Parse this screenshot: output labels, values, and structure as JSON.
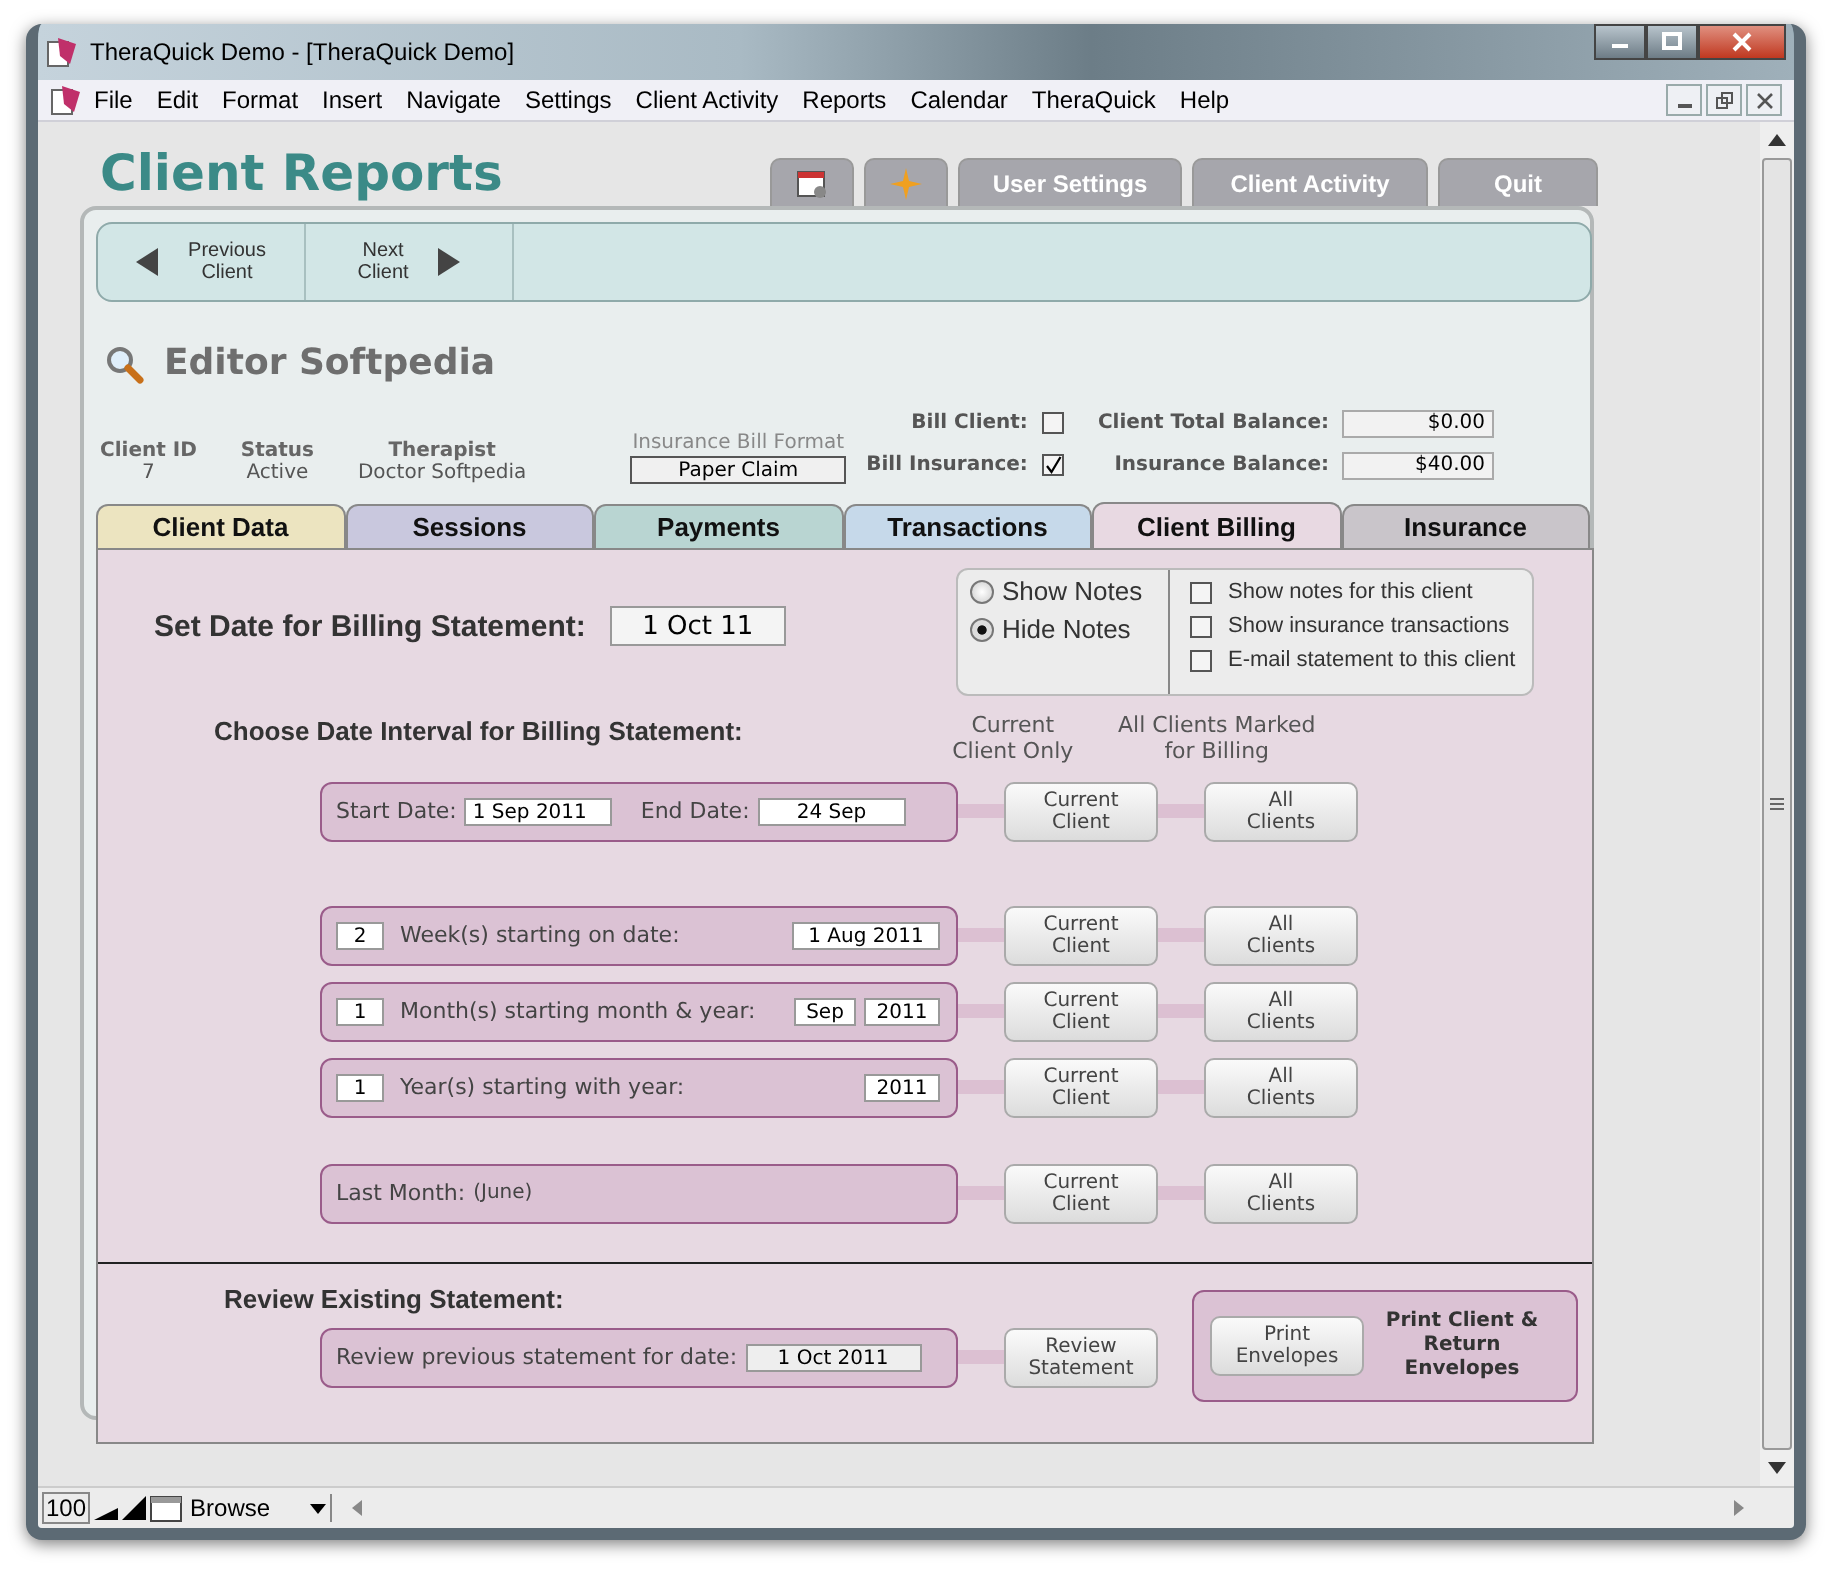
{
  "window": {
    "title": "TheraQuick Demo - [TheraQuick Demo]"
  },
  "menu": [
    "File",
    "Edit",
    "Format",
    "Insert",
    "Navigate",
    "Settings",
    "Client Activity",
    "Reports",
    "Calendar",
    "TheraQuick",
    "Help"
  ],
  "header": {
    "title": "Client Reports",
    "tabs": [
      {
        "kind": "calendar"
      },
      {
        "kind": "star"
      },
      {
        "kind": "text",
        "label": "User Settings"
      },
      {
        "kind": "text",
        "label": "Client Activity"
      },
      {
        "kind": "text",
        "label": "Quit"
      }
    ]
  },
  "navigation": {
    "previous": "Previous Client",
    "next": "Next Client"
  },
  "client": {
    "name": "Editor Softpedia",
    "fields": [
      {
        "label": "Client ID",
        "value": "7"
      },
      {
        "label": "Status",
        "value": "Active"
      },
      {
        "label": "Therapist",
        "value": "Doctor Softpedia"
      }
    ],
    "insurance_bill_format": {
      "label": "Insurance Bill Format",
      "value": "Paper Claim"
    },
    "bill_options": [
      {
        "label": "Bill Client:",
        "checked": false
      },
      {
        "label": "Bill Insurance:",
        "checked": true
      }
    ],
    "balances": [
      {
        "label": "Client Total Balance:",
        "value": "$0.00"
      },
      {
        "label": "Insurance Balance:",
        "value": "$40.00"
      }
    ]
  },
  "tabs": [
    {
      "label": "Client Data",
      "color": "#ece4c0",
      "selected": false
    },
    {
      "label": "Sessions",
      "color": "#c9c8de",
      "selected": false
    },
    {
      "label": "Payments",
      "color": "#b9d5d2",
      "selected": false
    },
    {
      "label": "Transactions",
      "color": "#c6d9ea",
      "selected": false
    },
    {
      "label": "Client Billing",
      "color": "#e8d9e2",
      "selected": true
    },
    {
      "label": "Insurance",
      "color": "#c9c5ca",
      "selected": false
    }
  ],
  "billing": {
    "statement_date": {
      "label": "Set Date for Billing Statement:",
      "value": "1 Oct 11"
    },
    "notes_options": [
      {
        "label": "Show Notes",
        "selected": false
      },
      {
        "label": "Hide Notes",
        "selected": true
      }
    ],
    "options": [
      {
        "label": "Show notes for this client",
        "checked": false
      },
      {
        "label": "Show insurance transactions",
        "checked": false
      },
      {
        "label": "E-mail statement to this client",
        "checked": false
      }
    ],
    "interval_heading": "Choose Date Interval for Billing Statement:",
    "column_headings": [
      "Current Client Only",
      "All Clients Marked for Billing"
    ],
    "intervals": [
      {
        "kind": "range",
        "start_label": "Start Date:",
        "start": "1 Sep 2011",
        "end_label": "End Date:",
        "end": "24 Sep",
        "buttons": [
          "Current Client",
          "All Clients"
        ]
      },
      {
        "kind": "weeks",
        "count": "2",
        "label": "Week(s) starting on date:",
        "date": "1 Aug 2011",
        "buttons": [
          "Current Client",
          "All Clients"
        ]
      },
      {
        "kind": "months",
        "count": "1",
        "label": "Month(s) starting month & year:",
        "month": "Sep",
        "year": "2011",
        "buttons": [
          "Current Client",
          "All Clients"
        ]
      },
      {
        "kind": "years",
        "count": "1",
        "label": "Year(s) starting with year:",
        "year": "2011",
        "buttons": [
          "Current Client",
          "All Clients"
        ]
      },
      {
        "kind": "last_month",
        "label": "Last Month:",
        "note": "(June)",
        "buttons": [
          "Current Client",
          "All Clients"
        ]
      }
    ],
    "review": {
      "heading": "Review Existing Statement:",
      "label": "Review previous statement for date:",
      "date": "1 Oct 2011",
      "button": "Review Statement"
    },
    "print": {
      "button": "Print Envelopes",
      "label": "Print Client & Return Envelopes"
    }
  },
  "status_bar": {
    "zoom": "100",
    "mode": "Browse"
  }
}
